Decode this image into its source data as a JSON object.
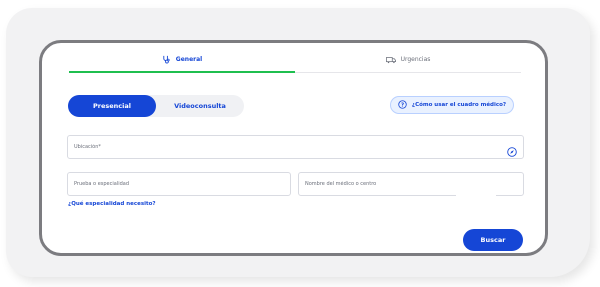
{
  "tabs": [
    {
      "label": "General",
      "icon": "stethoscope-icon",
      "active": true
    },
    {
      "label": "Urgencias",
      "icon": "ambulance-icon",
      "active": false
    }
  ],
  "mode_toggle": {
    "options": [
      "Presencial",
      "Videoconsulta"
    ],
    "selected": "Presencial"
  },
  "help_link": {
    "label": "¿Cómo usar el cuadro médico?",
    "icon": "help-circle-icon"
  },
  "fields": {
    "location": {
      "placeholder": "Ubicación*",
      "value": ""
    },
    "specialty": {
      "placeholder": "Prueba o especialidad",
      "value": ""
    },
    "doctor": {
      "placeholder": "Nombre del médico o centro",
      "value": ""
    }
  },
  "specialty_help": {
    "label": "¿Qué especialidad necesito?"
  },
  "search_button": {
    "label": "Buscar"
  },
  "colors": {
    "primary": "#1546d6",
    "tab_underline": "#1fbf4f",
    "frame_border": "#7c7c80",
    "help_bg": "#e9f1ff"
  }
}
